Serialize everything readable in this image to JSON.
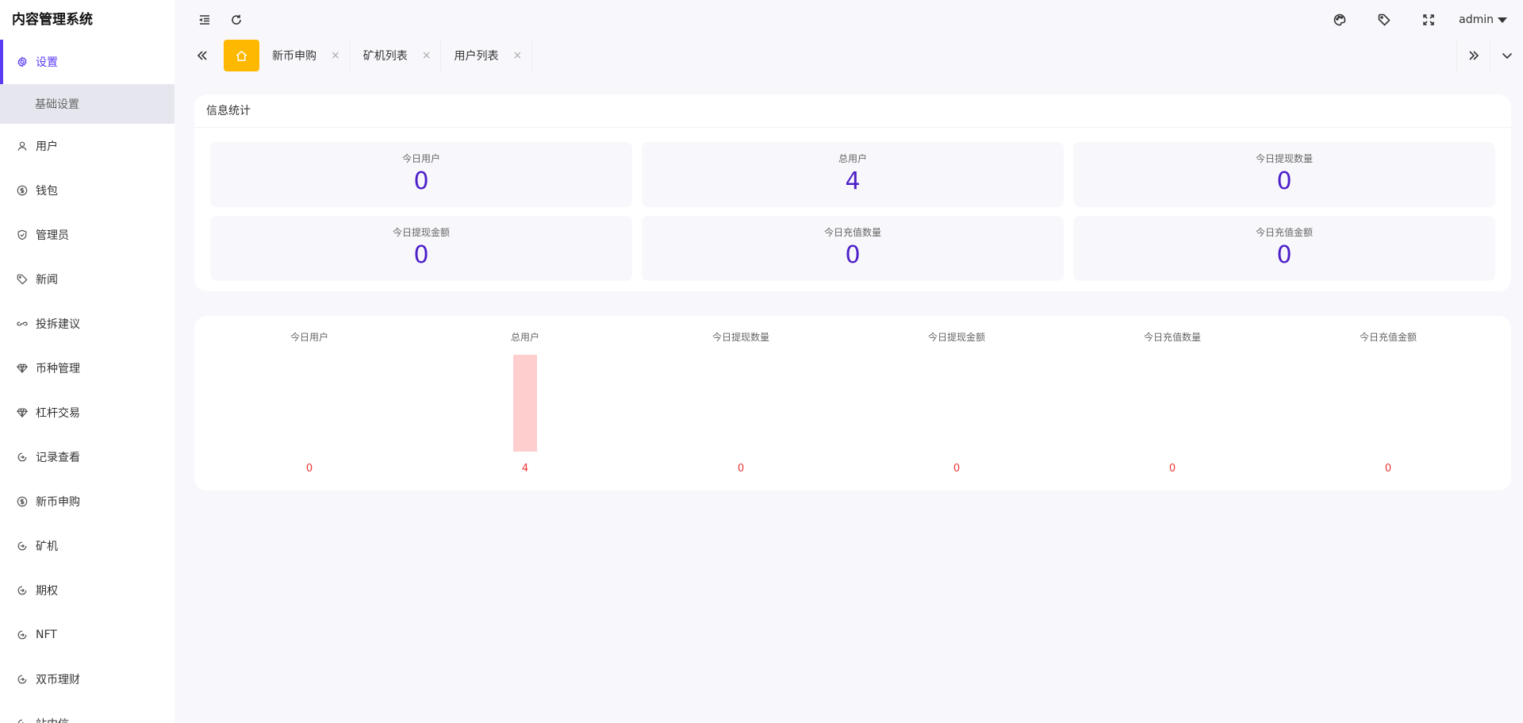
{
  "brand": "内容管理系统",
  "user": {
    "name": "admin"
  },
  "menu": {
    "active": "设置",
    "sub": "基础设置",
    "items": [
      "用户",
      "钱包",
      "管理员",
      "新闻",
      "投拆建议",
      "币种管理",
      "杠杆交易",
      "记录查看",
      "新币申购",
      "矿机",
      "期权",
      "NFT",
      "双币理财",
      "站内信"
    ]
  },
  "tabs": [
    "新币申购",
    "矿机列表",
    "用户列表"
  ],
  "tab_close": "×",
  "stats": {
    "title": "信息统计",
    "cards": [
      {
        "label": "今日用户",
        "value": "0"
      },
      {
        "label": "总用户",
        "value": "4"
      },
      {
        "label": "今日提现数量",
        "value": "0"
      },
      {
        "label": "今日提现金额",
        "value": "0"
      },
      {
        "label": "今日充值数量",
        "value": "0"
      },
      {
        "label": "今日充值金额",
        "value": "0"
      }
    ]
  },
  "chart_data": {
    "type": "bar",
    "categories": [
      "今日用户",
      "总用户",
      "今日提现数量",
      "今日提现金额",
      "今日充值数量",
      "今日充值金额"
    ],
    "values": [
      0,
      4,
      0,
      0,
      0,
      0
    ],
    "bar_color": "#fecece",
    "label_color": "#ee3333"
  },
  "colors": {
    "accent": "#5b3af5",
    "home_tab": "#ffb800",
    "stat_value": "#4d1fc9"
  }
}
